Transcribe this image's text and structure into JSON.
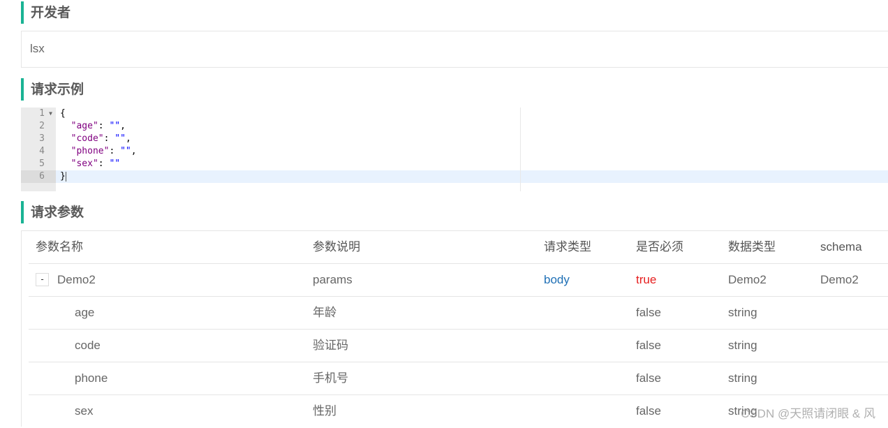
{
  "sections": {
    "developer": {
      "title": "开发者",
      "value": "lsx"
    },
    "request_example": {
      "title": "请求示例"
    },
    "request_params": {
      "title": "请求参数"
    }
  },
  "code": {
    "line_numbers": [
      "1",
      "2",
      "3",
      "4",
      "5",
      "6"
    ],
    "lines": [
      {
        "indent": "",
        "key": "",
        "value": "",
        "text": "{"
      },
      {
        "indent": "  ",
        "key": "\"age\"",
        "sep": ": ",
        "value": "\"\"",
        "tail": ","
      },
      {
        "indent": "  ",
        "key": "\"code\"",
        "sep": ": ",
        "value": "\"\"",
        "tail": ","
      },
      {
        "indent": "  ",
        "key": "\"phone\"",
        "sep": ": ",
        "value": "\"\"",
        "tail": ","
      },
      {
        "indent": "  ",
        "key": "\"sex\"",
        "sep": ": ",
        "value": "\"\"",
        "tail": ""
      },
      {
        "indent": "",
        "key": "",
        "value": "",
        "text": "}"
      }
    ],
    "active_line": 6
  },
  "table": {
    "headers": [
      "参数名称",
      "参数说明",
      "请求类型",
      "是否必须",
      "数据类型",
      "schema"
    ],
    "rows": [
      {
        "toggle": "-",
        "name": "Demo2",
        "desc": "params",
        "in": "body",
        "required": "true",
        "type": "Demo2",
        "schema": "Demo2"
      },
      {
        "name": "age",
        "desc": "年龄",
        "in": "",
        "required": "false",
        "type": "string",
        "schema": ""
      },
      {
        "name": "code",
        "desc": "验证码",
        "in": "",
        "required": "false",
        "type": "string",
        "schema": ""
      },
      {
        "name": "phone",
        "desc": "手机号",
        "in": "",
        "required": "false",
        "type": "string",
        "schema": ""
      },
      {
        "name": "sex",
        "desc": "性别",
        "in": "",
        "required": "false",
        "type": "string",
        "schema": ""
      }
    ]
  },
  "watermark": "CSDN @天照请闭眼 & 风",
  "colors": {
    "accent": "#1ab394",
    "link_blue": "#1e6fb5",
    "required_red": "#e61e1e",
    "active_line": "#e8f2fe"
  }
}
